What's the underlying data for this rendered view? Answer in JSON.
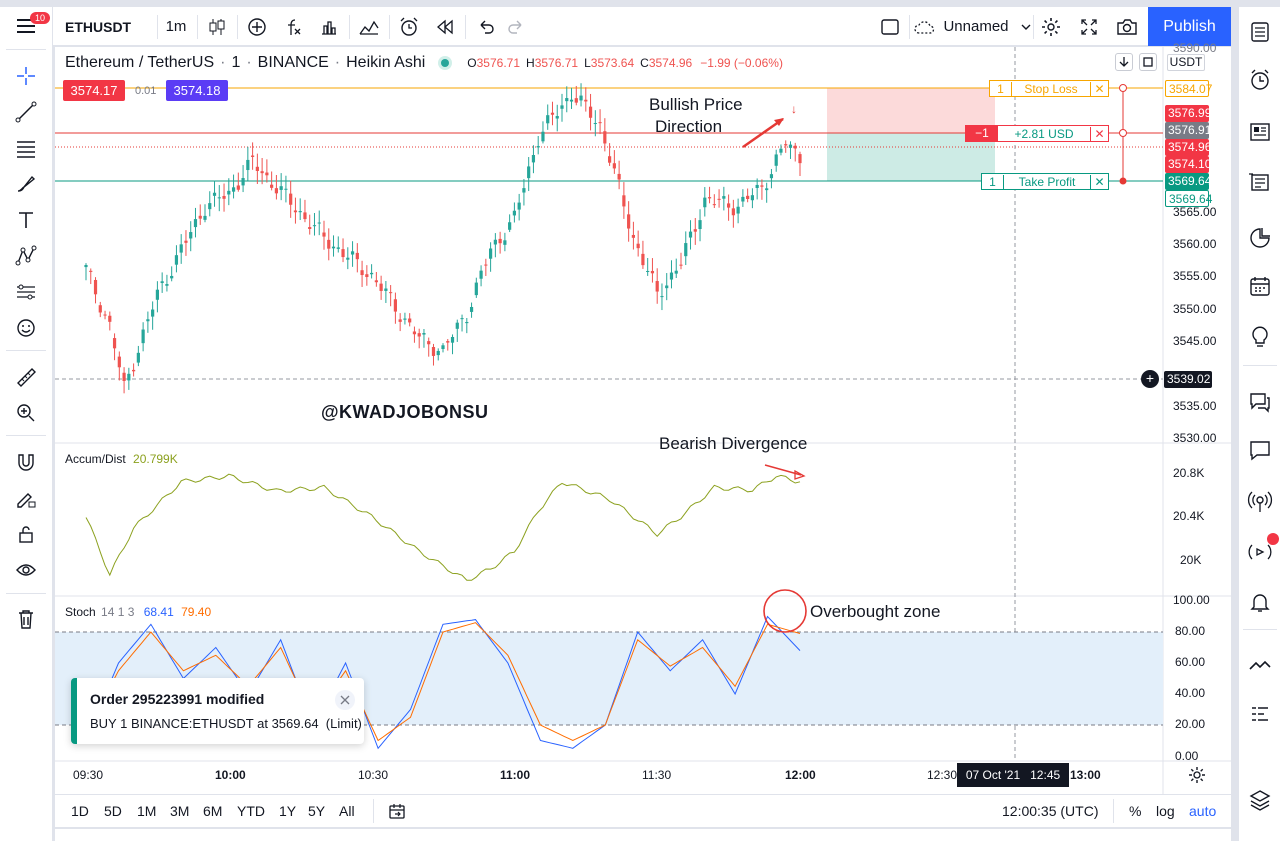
{
  "topbar": {
    "symbol": "ETHUSDT",
    "interval": "1m",
    "layout_name": "Unnamed",
    "publish_label": "Publish",
    "notification_count": "10",
    "icons": [
      "bar-style-icon",
      "indicators-add-icon",
      "fx-icon",
      "templates-icon",
      "compare-icon",
      "alert-icon",
      "replay-icon",
      "undo-icon",
      "redo-icon"
    ]
  },
  "legend": {
    "title": "Ethereum / TetherUS",
    "interval": "1",
    "exchange": "BINANCE",
    "chart_style": "Heikin Ashi",
    "o_label": "O",
    "o": "3576.71",
    "h_label": "H",
    "h": "3576.71",
    "l_label": "L",
    "l": "3573.64",
    "c_label": "C",
    "c": "3574.96",
    "change": "−1.99 (−0.06%)",
    "bid": "3574.17",
    "spread": "0.01",
    "ask": "3574.18",
    "colors": {
      "up": "#26a69a",
      "down": "#ef5350"
    }
  },
  "price_axis": {
    "currency": "USDT",
    "ticks": [
      "3590.00",
      "3565.00",
      "3560.00",
      "3555.00",
      "3550.00",
      "3545.00",
      "3535.00",
      "3530.00"
    ],
    "labels": {
      "stop_loss": "3584.07",
      "red1": "3576.99",
      "gray": "3576.91",
      "current": "3574.96",
      "red2": "3574.10",
      "take_profit": "3569.64",
      "take_profit2": "3569.64",
      "crosshair": "3539.02"
    }
  },
  "position": {
    "stop_qty": "1",
    "stop_label": "Stop Loss",
    "pnl_qty": "−1",
    "pnl_label": "+2.81 USD",
    "tp_qty": "1",
    "tp_label": "Take Profit",
    "close_glyph": "✕"
  },
  "annotations": {
    "bullish": "Bullish Price\nDirection",
    "bullish_line1": "Bullish Price",
    "bullish_line2": "Direction",
    "watermark": "@KWADJOBONSU",
    "bearish": "Bearish Divergence",
    "overbought": "Overbought zone",
    "down_arrow": "↓"
  },
  "accum": {
    "name": "Accum/Dist",
    "value": "20.799K",
    "ticks": [
      "20.8K",
      "20.4K",
      "20K"
    ]
  },
  "stoch": {
    "name": "Stoch",
    "params": "14 1 3",
    "k": "68.41",
    "d": "79.40",
    "ticks": [
      "100.00",
      "80.00",
      "60.00",
      "40.00",
      "20.00",
      "0.00"
    ]
  },
  "time_axis": {
    "ticks": [
      "09:30",
      "10:00",
      "10:30",
      "11:00",
      "11:30",
      "12:00",
      "12:30",
      "13:00"
    ],
    "crosshair_label": "07 Oct '21   12:45"
  },
  "toast": {
    "title": "Order 295223991 modified",
    "body": "BUY 1 BINANCE:ETHUSDT at 3569.64  (Limit)"
  },
  "bottombar": {
    "ranges": [
      "1D",
      "5D",
      "1M",
      "3M",
      "6M",
      "YTD",
      "1Y",
      "5Y",
      "All"
    ],
    "clock": "12:00:35 (UTC)",
    "percent": "%",
    "log": "log",
    "auto": "auto"
  },
  "chart_data": [
    {
      "type": "candlestick",
      "title": "Ethereum / TetherUS · 1 · BINANCE · Heikin Ashi",
      "x_ticks": [
        "09:30",
        "10:00",
        "10:30",
        "11:00",
        "11:30",
        "12:00",
        "12:30",
        "13:00"
      ],
      "ylim": [
        3530,
        3592
      ],
      "ohlc_last": {
        "open": 3576.71,
        "high": 3576.71,
        "low": 3573.64,
        "close": 3574.96
      },
      "close_path": [
        {
          "t": "09:30",
          "v": 3557
        },
        {
          "t": "09:35",
          "v": 3548
        },
        {
          "t": "09:38",
          "v": 3538
        },
        {
          "t": "09:45",
          "v": 3553
        },
        {
          "t": "09:55",
          "v": 3567
        },
        {
          "t": "10:00",
          "v": 3569
        },
        {
          "t": "10:05",
          "v": 3574
        },
        {
          "t": "10:10",
          "v": 3570
        },
        {
          "t": "10:20",
          "v": 3562
        },
        {
          "t": "10:30",
          "v": 3556
        },
        {
          "t": "10:40",
          "v": 3546
        },
        {
          "t": "10:45",
          "v": 3544
        },
        {
          "t": "10:50",
          "v": 3550
        },
        {
          "t": "10:55",
          "v": 3560
        },
        {
          "t": "11:00",
          "v": 3565
        },
        {
          "t": "11:05",
          "v": 3578
        },
        {
          "t": "11:12",
          "v": 3585
        },
        {
          "t": "11:18",
          "v": 3580
        },
        {
          "t": "11:25",
          "v": 3562
        },
        {
          "t": "11:30",
          "v": 3553
        },
        {
          "t": "11:35",
          "v": 3558
        },
        {
          "t": "11:40",
          "v": 3568
        },
        {
          "t": "11:47",
          "v": 3567
        },
        {
          "t": "11:52",
          "v": 3570
        },
        {
          "t": "11:57",
          "v": 3577
        },
        {
          "t": "12:00",
          "v": 3575
        }
      ],
      "lines": {
        "stop_loss": 3584.07,
        "entry": 3576.91,
        "take_profit": 3569.64,
        "crosshair": 3539.02
      }
    },
    {
      "type": "line",
      "title": "Accum/Dist",
      "ylim": [
        19.85,
        21.1
      ],
      "unit": "K",
      "points": [
        {
          "t": "09:30",
          "v": 20.5
        },
        {
          "t": "09:35",
          "v": 20.0
        },
        {
          "t": "09:40",
          "v": 20.4
        },
        {
          "t": "09:50",
          "v": 20.8
        },
        {
          "t": "10:00",
          "v": 20.85
        },
        {
          "t": "10:10",
          "v": 20.72
        },
        {
          "t": "10:20",
          "v": 20.75
        },
        {
          "t": "10:30",
          "v": 20.5
        },
        {
          "t": "10:40",
          "v": 20.2
        },
        {
          "t": "10:50",
          "v": 19.95
        },
        {
          "t": "10:55",
          "v": 20.05
        },
        {
          "t": "11:00",
          "v": 20.2
        },
        {
          "t": "11:05",
          "v": 20.55
        },
        {
          "t": "11:10",
          "v": 20.8
        },
        {
          "t": "11:20",
          "v": 20.65
        },
        {
          "t": "11:30",
          "v": 20.35
        },
        {
          "t": "11:35",
          "v": 20.5
        },
        {
          "t": "11:42",
          "v": 20.75
        },
        {
          "t": "11:50",
          "v": 20.73
        },
        {
          "t": "11:55",
          "v": 20.85
        },
        {
          "t": "12:00",
          "v": 20.8
        }
      ]
    },
    {
      "type": "line",
      "title": "Stoch 14 1 3",
      "ylim": [
        0,
        100
      ],
      "bands": [
        20,
        80
      ],
      "series": [
        {
          "name": "%K",
          "values": [
            10,
            60,
            85,
            50,
            70,
            40,
            75,
            20,
            60,
            5,
            30,
            85,
            88,
            60,
            10,
            5,
            20,
            80,
            55,
            75,
            40,
            90,
            68
          ]
        },
        {
          "name": "%D",
          "values": [
            15,
            55,
            80,
            55,
            65,
            45,
            70,
            25,
            55,
            10,
            25,
            80,
            86,
            65,
            20,
            10,
            20,
            75,
            58,
            70,
            45,
            85,
            79
          ]
        }
      ],
      "last": {
        "k": 68.41,
        "d": 79.4
      }
    }
  ]
}
